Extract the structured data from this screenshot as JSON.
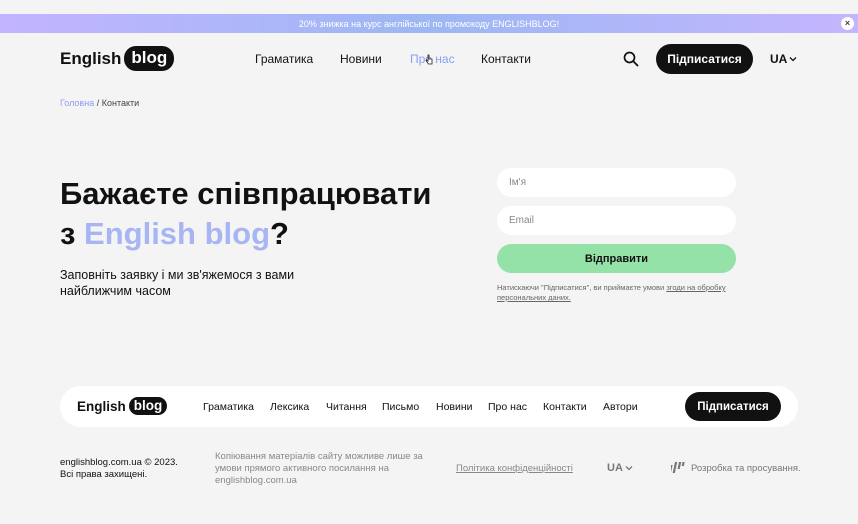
{
  "promo": {
    "text": "20% знижка на курс англійської по промокоду ENGLISHBLOG!",
    "close": "×"
  },
  "header": {
    "logo_word": "English",
    "logo_pill": "blog",
    "nav": [
      {
        "label": "Граматика"
      },
      {
        "label": "Новини"
      },
      {
        "label": "Про нас"
      },
      {
        "label": "Контакти"
      }
    ],
    "subscribe_label": "Підписатися",
    "lang": "UA"
  },
  "breadcrumb": {
    "home": "Головна",
    "separator": "/",
    "current": "Контакти"
  },
  "hero": {
    "title_line1": "Бажаєте співпрацювати",
    "title_prefix": "з ",
    "title_accent": "English blog",
    "title_suffix": "?",
    "subtitle": "Заповніть заявку і ми зв'яжемося з вами найближчим часом"
  },
  "form": {
    "name_placeholder": "Ім'я",
    "email_placeholder": "Email",
    "submit_label": "Відправити",
    "consent_text": "Натискаючи \"Підписатися\", ви приймаєте умови ",
    "consent_link": "згоди на обробку персональних даних."
  },
  "footer": {
    "logo_word": "English",
    "logo_pill": "blog",
    "nav": [
      {
        "label": "Граматика"
      },
      {
        "label": "Лексика"
      },
      {
        "label": "Читання"
      },
      {
        "label": "Письмо"
      },
      {
        "label": "Новини"
      },
      {
        "label": "Про нас"
      },
      {
        "label": "Контакти"
      },
      {
        "label": "Автори"
      }
    ],
    "subscribe_label": "Підписатися",
    "copyright_line1": "englishblog.com.ua © 2023.",
    "copyright_line2": "Всі права захищені.",
    "copy_note": "Копіювання матеріалів сайту можливе лише за умови прямого активного посилання на englishblog.com.ua",
    "policy": "Політика конфіденційності",
    "lang": "UA",
    "studio": "Розробка та просування."
  },
  "colors": {
    "accent": "#8b9ef3",
    "send_button": "#94e2a8",
    "dark": "#111111"
  }
}
